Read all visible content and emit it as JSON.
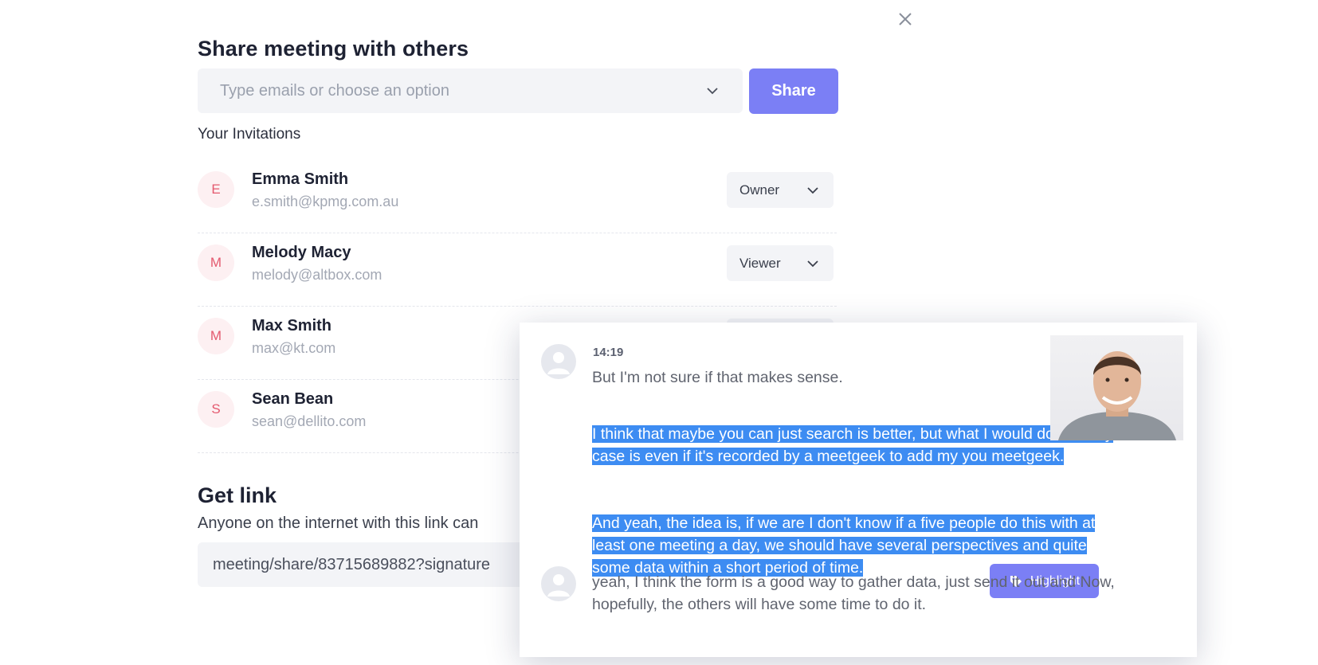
{
  "close": {
    "icon": "close-icon"
  },
  "share": {
    "title": "Share meeting with others",
    "email_placeholder": "Type emails or choose an option",
    "share_label": "Share",
    "invitations_label": "Your Invitations",
    "invitations": [
      {
        "initial": "E",
        "name": "Emma Smith",
        "email": "e.smith@kpmg.com.au",
        "role": "Owner"
      },
      {
        "initial": "M",
        "name": "Melody Macy",
        "email": "melody@altbox.com",
        "role": "Viewer"
      },
      {
        "initial": "M",
        "name": "Max Smith",
        "email": "max@kt.com",
        "role": ""
      },
      {
        "initial": "S",
        "name": "Sean Bean",
        "email": "sean@dellito.com",
        "role": ""
      }
    ]
  },
  "link": {
    "title": "Get link",
    "description": "Anyone on the internet with this link can",
    "url": "meeting/share/83715689882?signature"
  },
  "transcript": {
    "time": "14:19",
    "line1": "But I'm not sure if that makes sense.",
    "highlight1": "I think that maybe you can just search is better, but what I would do in every case is even if it's recorded by a meetgeek to add my you meetgeek.",
    "highlight2": "And yeah, the idea is, if we are I don't know if a five people do this with at least one meeting a day, we should have several perspectives and quite some data within a short period of time.",
    "highlight_button": "Highlight",
    "line2": "yeah, I think the form is a good way to gather data, just send it out and Now, hopefully, the others will have some time to do it."
  },
  "colors": {
    "accent": "#7b7ff5",
    "selection": "#3d8cf2",
    "avatar_bg": "#fdf0f2",
    "avatar_text": "#e45a6f",
    "field_bg": "#f3f4f7"
  }
}
